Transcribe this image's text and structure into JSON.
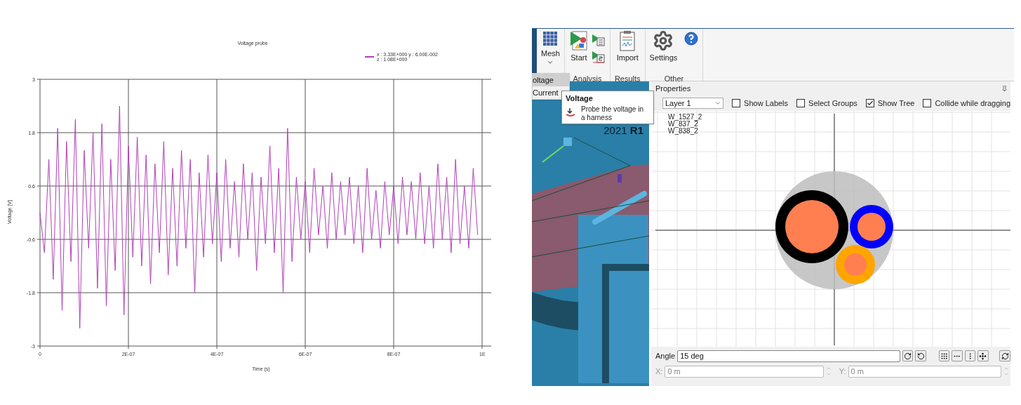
{
  "chart": {
    "edge_tick_label": "1E",
    "legend": [
      "x : 3.33E+000   y : 6.00E-002",
      "z : 1.08E+000"
    ],
    "chart_data": {
      "type": "line",
      "title": "Voltage probe",
      "xlabel": "Time (s)",
      "ylabel": "Voltage [V]",
      "xlim": [
        0,
        1e-06
      ],
      "ylim": [
        -3,
        3
      ],
      "xticks": [
        {
          "value": 0,
          "label": "0"
        },
        {
          "value": 2e-07,
          "label": "2E-07"
        },
        {
          "value": 4e-07,
          "label": "4E-07"
        },
        {
          "value": 6e-07,
          "label": "6E-07"
        },
        {
          "value": 8e-07,
          "label": "8E-07"
        }
      ],
      "yticks": [
        {
          "value": 3,
          "label": "3"
        },
        {
          "value": 1.8,
          "label": "1.8"
        },
        {
          "value": 0.6,
          "label": "0.6"
        },
        {
          "value": -0.6,
          "label": "-0.6"
        },
        {
          "value": -1.8,
          "label": "-1.8"
        },
        {
          "value": -3,
          "label": "-3"
        }
      ],
      "grid": true,
      "x": [
        0,
        1e-08,
        2e-08,
        3e-08,
        4e-08,
        5e-08,
        6e-08,
        7e-08,
        8e-08,
        9e-08,
        1e-07,
        1.1e-07,
        1.2e-07,
        1.3e-07,
        1.4e-07,
        1.5e-07,
        1.6e-07,
        1.7e-07,
        1.8e-07,
        1.9e-07,
        2e-07,
        2.1e-07,
        2.2e-07,
        2.3e-07,
        2.4e-07,
        2.5e-07,
        2.6e-07,
        2.7e-07,
        2.8e-07,
        2.9e-07,
        3e-07,
        3.1e-07,
        3.2e-07,
        3.3e-07,
        3.4e-07,
        3.5e-07,
        3.6e-07,
        3.7e-07,
        3.8e-07,
        3.9e-07,
        4e-07,
        4.1e-07,
        4.2e-07,
        4.3e-07,
        4.4e-07,
        4.5e-07,
        4.6e-07,
        4.7e-07,
        4.8e-07,
        4.9e-07,
        5e-07,
        5.1e-07,
        5.2e-07,
        5.3e-07,
        5.4e-07,
        5.5e-07,
        5.6e-07,
        5.7e-07,
        5.8e-07,
        5.9e-07,
        6e-07,
        6.1e-07,
        6.2e-07,
        6.3e-07,
        6.4e-07,
        6.5e-07,
        6.6e-07,
        6.7e-07,
        6.8e-07,
        6.9e-07,
        7e-07,
        7.1e-07,
        7.2e-07,
        7.3e-07,
        7.4e-07,
        7.5e-07,
        7.6e-07,
        7.7e-07,
        7.8e-07,
        7.9e-07,
        8e-07,
        8.1e-07,
        8.2e-07,
        8.3e-07,
        8.4e-07,
        8.5e-07,
        8.6e-07,
        8.7e-07,
        8.8e-07,
        8.9e-07,
        9e-07,
        9.1e-07,
        9.2e-07,
        9.3e-07,
        9.4e-07,
        9.5e-07,
        9.6e-07,
        9.7e-07,
        9.8e-07,
        9.9e-07
      ],
      "series": [
        {
          "color": "#b040b8",
          "values": [
            0,
            -0.9,
            1.2,
            -1.5,
            1.9,
            -2.2,
            1.6,
            -1.1,
            2.1,
            -2.6,
            1.4,
            -0.8,
            1.8,
            -1.7,
            2.0,
            -2.1,
            1.2,
            -1.3,
            2.4,
            -2.3,
            1.5,
            -1.0,
            1.7,
            -1.2,
            1.3,
            -1.6,
            1.1,
            -0.9,
            1.6,
            -1.4,
            1.0,
            -1.2,
            1.4,
            -0.8,
            1.2,
            -1.8,
            0.9,
            -1.0,
            1.3,
            -0.7,
            0.9,
            -1.1,
            1.2,
            -0.8,
            0.7,
            -1.0,
            1.1,
            -0.6,
            0.9,
            -1.3,
            0.8,
            -0.7,
            1.5,
            -0.9,
            1.0,
            -1.8,
            1.9,
            -1.1,
            0.8,
            -0.6,
            0.7,
            -0.9,
            1.0,
            -0.5,
            0.6,
            -0.8,
            0.9,
            -0.6,
            0.7,
            -0.5,
            0.8,
            -0.7,
            0.6,
            -0.9,
            1.0,
            -0.6,
            0.5,
            -0.8,
            0.7,
            -0.5,
            0.6,
            -0.7,
            0.8,
            -0.5,
            0.7,
            -0.6,
            0.9,
            -0.7,
            0.6,
            -0.8,
            1.1,
            -0.6,
            0.8,
            -0.9,
            1.2,
            -0.7,
            0.6,
            -0.8,
            1.0,
            -0.5
          ]
        }
      ]
    }
  },
  "ribbon": {
    "groups": [
      {
        "buttons": [
          {
            "kind": "mesh",
            "label": "Mesh"
          }
        ]
      },
      {
        "label": "Analysis",
        "buttons": [
          {
            "kind": "start",
            "label": "Start"
          }
        ]
      },
      {
        "label": "Results",
        "buttons": [
          {
            "kind": "import",
            "label": "Import"
          }
        ]
      },
      {
        "label": "Other",
        "buttons": [
          {
            "kind": "settings",
            "label": "Settings"
          }
        ]
      }
    ]
  },
  "menu": {
    "items": [
      {
        "label": "oltage",
        "selected": true
      },
      {
        "label": "Current",
        "selected": false
      }
    ]
  },
  "tooltip": {
    "title": "Voltage",
    "text": "Probe the voltage in a harness"
  },
  "viewport": {
    "version": "2021 **R1**"
  },
  "properties": {
    "title": "Properties",
    "layer": "Layer 1",
    "options": [
      {
        "label": "Show Labels",
        "checked": false
      },
      {
        "label": "Select Groups",
        "checked": false
      },
      {
        "label": "Show Tree",
        "checked": true
      },
      {
        "label": "Collide while dragging",
        "checked": false
      }
    ],
    "tree": [
      "W_1527_2",
      "W_837_2",
      "W_838_2"
    ],
    "angle": {
      "label": "Angle",
      "value": "15 deg"
    },
    "x": {
      "label": "X:",
      "value": "0 m",
      "disabled": true
    },
    "y": {
      "label": "Y:",
      "value": "0 m",
      "disabled": true
    }
  }
}
